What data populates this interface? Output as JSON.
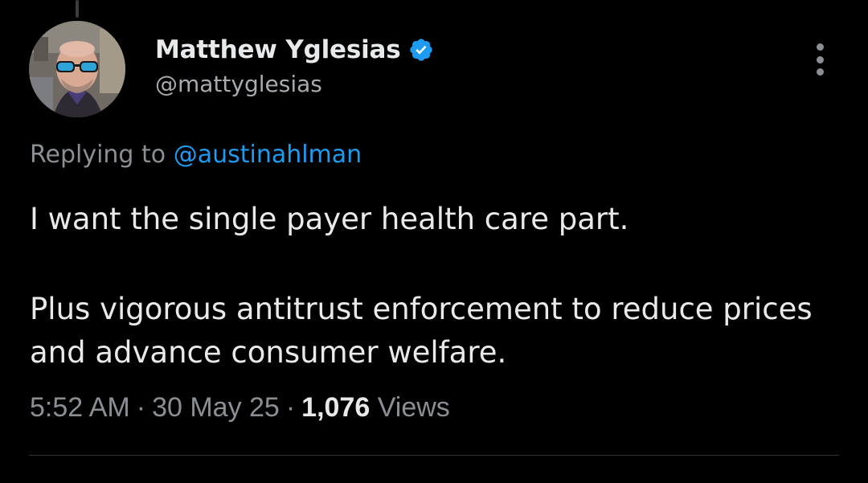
{
  "author": {
    "display_name": "Matthew Yglesias",
    "handle": "@mattyglesias",
    "verified": true,
    "verified_badge_color": "#1d9bf0"
  },
  "reply": {
    "prefix": "Replying to",
    "mention": "@austinahlman",
    "mention_color": "#1d9bf0"
  },
  "tweet": {
    "paragraphs": [
      "I want the single payer health care part.",
      "Plus vigorous antitrust enforcement to reduce prices and advance consumer welfare."
    ]
  },
  "meta": {
    "time": "5:52 AM",
    "date": "30 May 25",
    "separator": "·",
    "views_count": "1,076",
    "views_label": "Views"
  },
  "icons": {
    "more": "more-vertical-icon",
    "verified": "verified-badge-icon"
  },
  "colors": {
    "background": "#000000",
    "primary_text": "#e7e9ea",
    "secondary_text": "#8b8f94",
    "accent": "#1d9bf0",
    "divider": "#2f3336"
  }
}
